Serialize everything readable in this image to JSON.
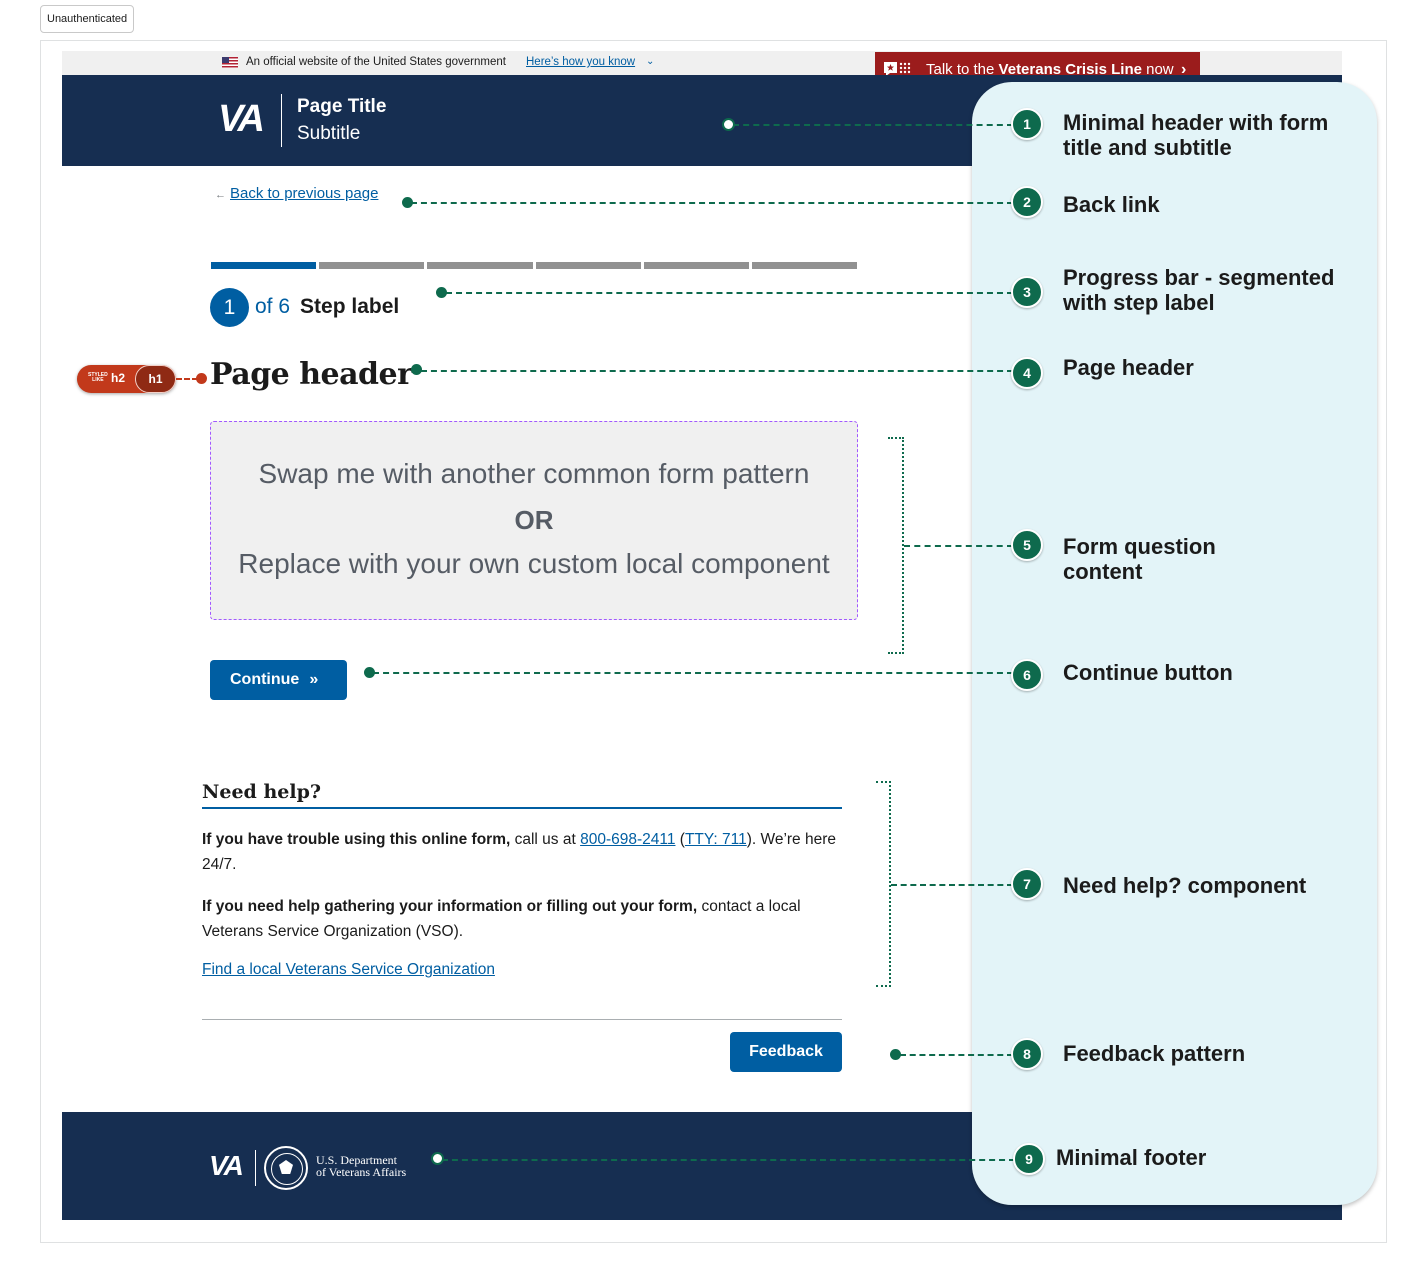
{
  "page": {
    "tag": "Unauthenticated"
  },
  "gov_banner": {
    "official_text": "An official website of the United States government",
    "how_you_know": "Here’s how you know",
    "flag_icon": "us-flag-icon",
    "chevron_icon": "chevron-down-icon"
  },
  "crisis_line": {
    "pre": "Talk to the ",
    "bold": "Veterans Crisis Line",
    "post": " now",
    "icon": "crisis-chat-icon"
  },
  "header": {
    "logo": "VA",
    "title": "Page Title",
    "subtitle": "Subtitle"
  },
  "back_link": {
    "label": "Back to previous page"
  },
  "progress": {
    "segments_total": 6,
    "current": "1",
    "of_text": "of 6",
    "step_label": "Step label"
  },
  "heading_tag": {
    "styled_like": "STYLED LIKE",
    "styled_as": "h2",
    "level": "h1"
  },
  "page_header": "Page header",
  "placeholder": {
    "line1": "Swap me with another common form pattern",
    "line2": "OR",
    "line3": "Replace with your own custom local component"
  },
  "continue_button": {
    "label": "Continue",
    "icon": "double-chevron-right-icon"
  },
  "need_help": {
    "title": "Need help?",
    "p1_bold": "If you have trouble using this online form,",
    "p1_text": " call us at ",
    "phone": "800-698-2411",
    "tty": "TTY: 711",
    "p1_end": "). We’re here 24/7.",
    "p2_bold": "If you need help gathering your information or filling out your form,",
    "p2_text": " contact a local Veterans Service Organization (VSO).",
    "find_link": "Find a local Veterans Service Organization"
  },
  "feedback_button": {
    "label": "Feedback"
  },
  "footer": {
    "logo": "VA",
    "dept_line1": "U.S. Department",
    "dept_line2": "of Veterans Affairs"
  },
  "annotations": [
    {
      "number": "1",
      "text": "Minimal header with form title and subtitle"
    },
    {
      "number": "2",
      "text": "Back link"
    },
    {
      "number": "3",
      "text": "Progress bar - segmented with step label"
    },
    {
      "number": "4",
      "text": "Page header"
    },
    {
      "number": "5",
      "text": "Form question content"
    },
    {
      "number": "6",
      "text": "Continue button"
    },
    {
      "number": "7",
      "text": "Need help? component"
    },
    {
      "number": "8",
      "text": "Feedback pattern"
    },
    {
      "number": "9",
      "text": "Minimal footer"
    }
  ],
  "colors": {
    "va_navy": "#162e51",
    "primary_blue": "#005ea2",
    "crisis_red": "#9b1c1c",
    "annotation_green": "#0e6a4d",
    "annotation_panel": "#e3f4f8",
    "heading_tag": "#c2391b"
  }
}
